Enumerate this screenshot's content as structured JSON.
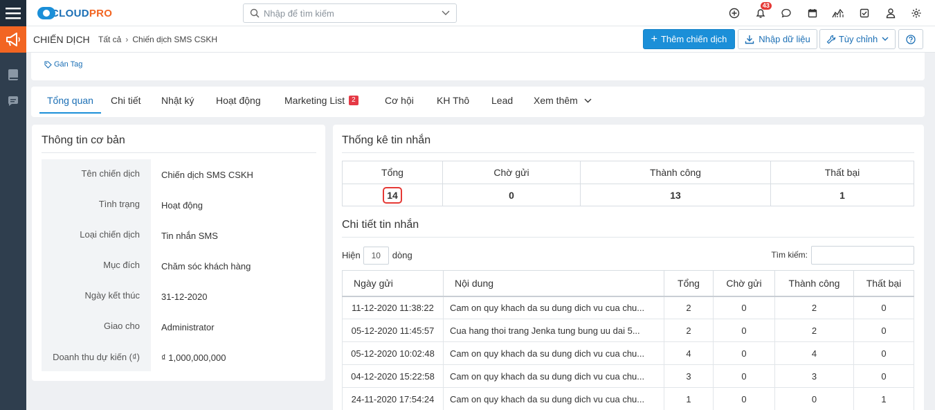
{
  "app": {
    "logo_main": "CLOUD",
    "logo_accent": "PRO"
  },
  "search": {
    "placeholder": "Nhập để tìm kiếm"
  },
  "header_icons": [
    "plus-circle-icon",
    "bell-icon",
    "chat-icon",
    "calendar-icon",
    "chart-icon",
    "checkbox-icon",
    "user-icon",
    "gear-icon"
  ],
  "notifications": {
    "count": "43"
  },
  "breadcrumb": {
    "title": "CHIẾN DỊCH",
    "items": [
      "Tất cả",
      "Chiến dịch SMS CSKH"
    ]
  },
  "actions": {
    "add": "Thêm chiến dịch",
    "import": "Nhập dữ liệu",
    "customize": "Tùy chỉnh"
  },
  "tag": {
    "label": "Gán Tag"
  },
  "tabs": [
    {
      "label": "Tổng quan"
    },
    {
      "label": "Chi tiết"
    },
    {
      "label": "Nhật ký"
    },
    {
      "label": "Hoạt động"
    },
    {
      "label": "Marketing List",
      "badge": "2"
    },
    {
      "label": "Cơ hội"
    },
    {
      "label": "KH Thô"
    },
    {
      "label": "Lead"
    },
    {
      "label": "Xem thêm"
    }
  ],
  "basic_info": {
    "title": "Thông tin cơ bản",
    "rows": [
      {
        "label": "Tên chiến dịch",
        "value": "Chiến dịch SMS CSKH"
      },
      {
        "label": "Tình trạng",
        "value": "Hoạt động"
      },
      {
        "label": "Loại chiến dịch",
        "value": "Tin nhắn SMS"
      },
      {
        "label": "Mục đích",
        "value": "Chăm sóc khách hàng"
      },
      {
        "label": "Ngày kết thúc",
        "value": "31-12-2020"
      },
      {
        "label": "Giao cho",
        "value": "Administrator"
      },
      {
        "label": "Doanh thu dự kiến (₫)",
        "value": "₫ 1,000,000,000"
      }
    ]
  },
  "stats": {
    "title": "Thống kê tin nhắn",
    "headers": [
      "Tổng",
      "Chờ gửi",
      "Thành công",
      "Thất bại"
    ],
    "values": [
      "14",
      "0",
      "13",
      "1"
    ]
  },
  "details": {
    "title": "Chi tiết tin nhắn",
    "show_label": "Hiện",
    "page_size": "10",
    "rows_label": "dòng",
    "search_label": "Tìm kiếm:",
    "columns": [
      "Ngày gửi",
      "Nội dung",
      "Tổng",
      "Chờ gửi",
      "Thành công",
      "Thất bại"
    ],
    "rows": [
      [
        "11-12-2020 11:38:22",
        "Cam on quy khach da su dung dich vu cua chu...",
        "2",
        "0",
        "2",
        "0"
      ],
      [
        "05-12-2020 11:45:57",
        "Cua hang thoi trang Jenka tung bung uu dai 5...",
        "2",
        "0",
        "2",
        "0"
      ],
      [
        "05-12-2020 10:02:48",
        "Cam on quy khach da su dung dich vu cua chu...",
        "4",
        "0",
        "4",
        "0"
      ],
      [
        "04-12-2020 15:22:58",
        "Cam on quy khach da su dung dich vu cua chu...",
        "3",
        "0",
        "3",
        "0"
      ],
      [
        "24-11-2020 17:54:24",
        "Cam on quy khach da su dung dich vu cua chu...",
        "1",
        "0",
        "0",
        "1"
      ]
    ]
  }
}
